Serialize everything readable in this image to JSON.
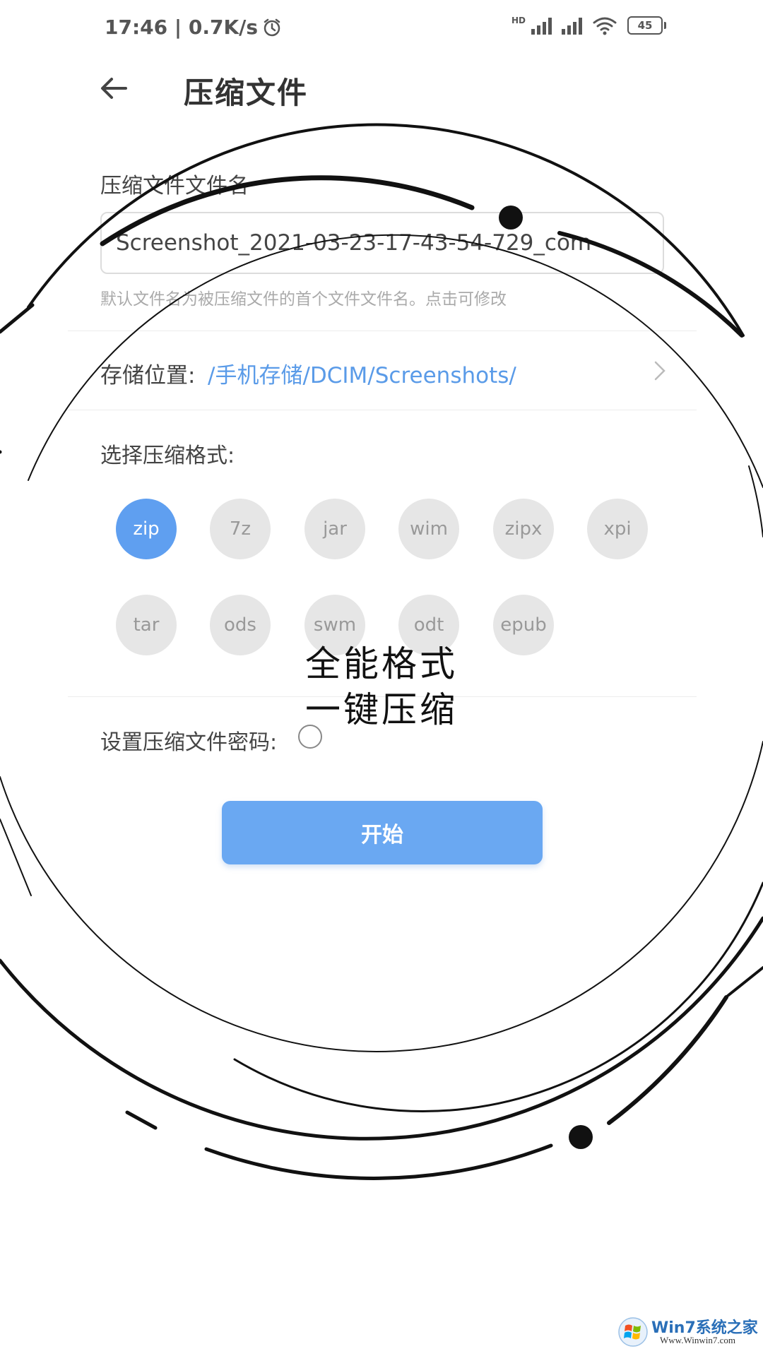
{
  "status_bar": {
    "time_speed": "17:46 | 0.7K/s",
    "hd_label": "HD",
    "battery": "45"
  },
  "header": {
    "title": "压缩文件"
  },
  "filename": {
    "label": "压缩文件文件名",
    "value": "Screenshot_2021-03-23-17-43-54-729_com",
    "hint": "默认文件名为被压缩文件的首个文件文件名。点击可修改"
  },
  "storage": {
    "label": "存储位置:",
    "path": "/手机存储/DCIM/Screenshots/"
  },
  "format": {
    "label": "选择压缩格式:",
    "selected": "zip",
    "options": [
      "zip",
      "7z",
      "jar",
      "wim",
      "zipx",
      "xpi",
      "tar",
      "ods",
      "swm",
      "odt",
      "epub"
    ]
  },
  "password": {
    "label": "设置压缩文件密码:"
  },
  "start_button": "开始",
  "overlay": {
    "slogan_line1": "全能格式",
    "slogan_line2": "一键压缩"
  },
  "watermark": {
    "title": "Win7系统之家",
    "url": "Www.Winwin7.com"
  },
  "colors": {
    "accent": "#5f9ff0",
    "button": "#6aa8f2",
    "link": "#5a9be8",
    "chip_bg": "#e6e6e6"
  }
}
